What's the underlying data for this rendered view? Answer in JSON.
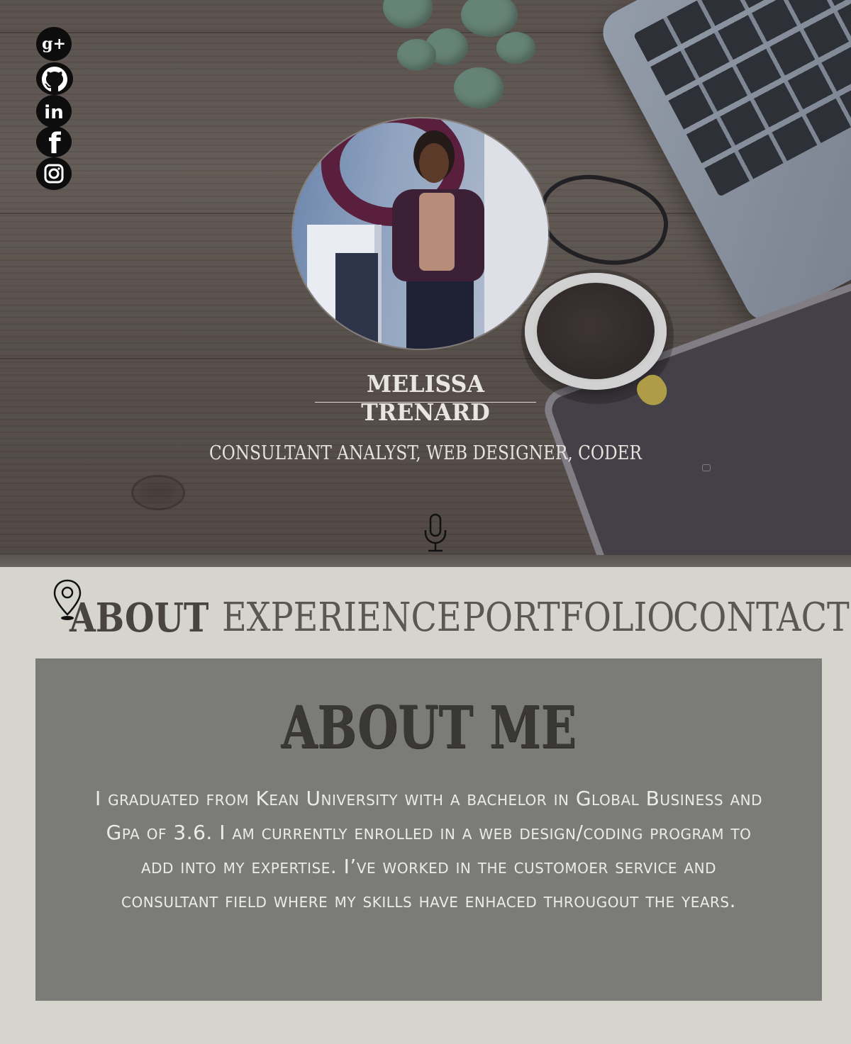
{
  "social": {
    "items": [
      {
        "name": "google-plus",
        "glyph": "g+"
      },
      {
        "name": "github"
      },
      {
        "name": "linkedin",
        "glyph": "in"
      },
      {
        "name": "facebook",
        "glyph": "f"
      },
      {
        "name": "instagram"
      }
    ]
  },
  "profile": {
    "name": "MELISSA TRENARD",
    "subtitle": "CONSULTANT ANALYST, WEB DESIGNER, CODER"
  },
  "nav": {
    "items": [
      {
        "label": "ABOUT",
        "active": true
      },
      {
        "label": "EXPERIENCE",
        "active": false
      },
      {
        "label": "PORTFOLIO",
        "active": false
      },
      {
        "label": "CONTACT",
        "active": false
      }
    ],
    "active_icon": "map-pin-icon"
  },
  "about": {
    "title": "ABOUT ME",
    "text": "I graduated from Kean University with a bachelor in Global Business and Gpa of 3.6. I am currently enrolled in a web design/coding program to add into my expertise. I’ve worked in the customoer service and consultant field where my skills have enhaced througout the years."
  },
  "colors": {
    "page_bg": "#d5d4cd",
    "about_bg": "#7b7c78",
    "nav_text": "#5b5753",
    "hero_text": "#e9e6e2"
  }
}
